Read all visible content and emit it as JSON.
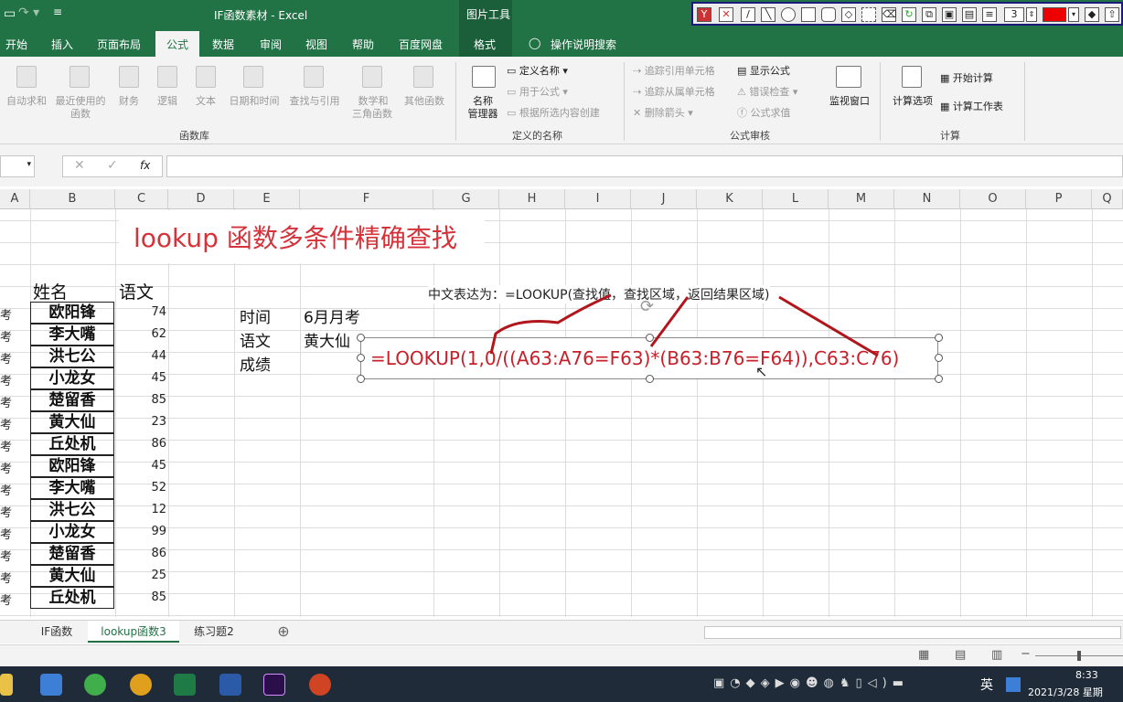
{
  "window": {
    "title": "IF函数素材  -  Excel",
    "picture_tools": "图片工具"
  },
  "tabs": [
    "开始",
    "插入",
    "页面布局",
    "公式",
    "数据",
    "审阅",
    "视图",
    "帮助",
    "百度网盘",
    "格式"
  ],
  "tell_me": "操作说明搜索",
  "ribbon": {
    "lib": [
      {
        "label": "自动求和",
        "icon": "sigma-icon"
      },
      {
        "label": "最近使用的",
        "label2": "函数",
        "icon": "star-icon"
      },
      {
        "label": "财务",
        "icon": "finance-icon"
      },
      {
        "label": "逻辑",
        "icon": "question-icon"
      },
      {
        "label": "文本",
        "icon": "text-a-icon"
      },
      {
        "label": "日期和时间",
        "icon": "calendar-icon"
      },
      {
        "label": "查找与引用",
        "icon": "lookup-icon"
      },
      {
        "label": "数学和",
        "label2": "三角函数",
        "icon": "theta-icon"
      },
      {
        "label": "其他函数",
        "icon": "more-icon"
      }
    ],
    "lib_group": "函数库",
    "names": {
      "manager": "名称",
      "manager2": "管理器",
      "define": "定义名称",
      "use": "用于公式",
      "create": "根据所选内容创建",
      "group": "定义的名称"
    },
    "audit": {
      "trace_pre": "追踪引用单元格",
      "trace_dep": "追踪从属单元格",
      "remove": "删除箭头",
      "show": "显示公式",
      "check": "错误检查",
      "eval": "公式求值",
      "watch": "监视窗口",
      "group": "公式审核"
    },
    "calc": {
      "options": "计算选项",
      "now": "开始计算",
      "sheet": "计算工作表",
      "group": "计算"
    }
  },
  "formula_bar": {
    "fx": "fx",
    "cancel": "✕",
    "enter": "✓"
  },
  "columns": [
    "A",
    "B",
    "C",
    "D",
    "E",
    "F",
    "G",
    "H",
    "I",
    "J",
    "K",
    "L",
    "M",
    "N",
    "O",
    "P",
    "Q"
  ],
  "sheet": {
    "title": "lookup 函数多条件精确查找",
    "header_name": "姓名",
    "header_score": "语文",
    "rows": [
      {
        "n": "欧阳锋",
        "v": "74"
      },
      {
        "n": "李大嘴",
        "v": "62"
      },
      {
        "n": "洪七公",
        "v": "44"
      },
      {
        "n": "小龙女",
        "v": "45"
      },
      {
        "n": "楚留香",
        "v": "85"
      },
      {
        "n": "黄大仙",
        "v": "23"
      },
      {
        "n": "丘处机",
        "v": "86"
      },
      {
        "n": "欧阳锋",
        "v": "45"
      },
      {
        "n": "李大嘴",
        "v": "52"
      },
      {
        "n": "洪七公",
        "v": "12"
      },
      {
        "n": "小龙女",
        "v": "99"
      },
      {
        "n": "楚留香",
        "v": "86"
      },
      {
        "n": "黄大仙",
        "v": "25"
      },
      {
        "n": "丘处机",
        "v": "85"
      }
    ],
    "kao": "考",
    "e_labels": [
      "时间",
      "语文",
      "成绩"
    ],
    "f_values": [
      "6月月考",
      "黄大仙"
    ],
    "hint": "中文表达为：=LOOKUP(查找值，查找区域，返回结果区域)",
    "formula": "=LOOKUP(1,0/((A63:A76=F63)*(B63:B76=F64)),C63:C76)"
  },
  "sheet_tabs": [
    "IF函数",
    "lookup函数3",
    "练习题2"
  ],
  "add_sheet": "⊕",
  "taskbar": {
    "time": "8:33",
    "date": "2021/3/28 星期",
    "ime": "英"
  },
  "draw_toolbar": {
    "width_value": "3"
  },
  "colors": {
    "excel_green": "#217346",
    "title_red": "#d6323a",
    "annotation_red": "#b0161b",
    "formula_red": "#c8202a"
  }
}
